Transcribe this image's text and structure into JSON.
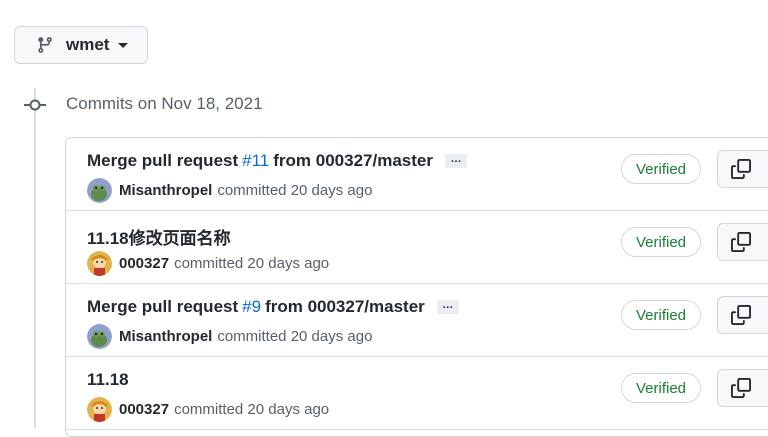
{
  "branch": {
    "name": "wmet",
    "icon": "git-branch-icon"
  },
  "group": {
    "title": "Commits on Nov 18, 2021",
    "icon": "git-commit-icon"
  },
  "commits": [
    {
      "title_prefix": "Merge pull request",
      "link": "#11",
      "title_suffix": "from 000327/master",
      "has_ellipsis": true,
      "ellipsis": "…",
      "author": "Misanthropel",
      "meta": "committed 20 days ago",
      "avatar": "avatar-frog",
      "badge": "Verified"
    },
    {
      "title_prefix": "11.18修改页面名称",
      "link": "",
      "title_suffix": "",
      "has_ellipsis": false,
      "ellipsis": "",
      "author": "000327",
      "meta": "committed 20 days ago",
      "avatar": "avatar-character",
      "badge": "Verified"
    },
    {
      "title_prefix": "Merge pull request",
      "link": "#9",
      "title_suffix": "from 000327/master",
      "has_ellipsis": true,
      "ellipsis": "…",
      "author": "Misanthropel",
      "meta": "committed 20 days ago",
      "avatar": "avatar-frog",
      "badge": "Verified"
    },
    {
      "title_prefix": "11.18",
      "link": "",
      "title_suffix": "",
      "has_ellipsis": false,
      "ellipsis": "",
      "author": "000327",
      "meta": "committed 20 days ago",
      "avatar": "avatar-character",
      "badge": "Verified"
    }
  ],
  "colors": {
    "link": "#0969da",
    "verified": "#1a7f37",
    "border": "#d0d7de",
    "muted": "#57606a"
  }
}
